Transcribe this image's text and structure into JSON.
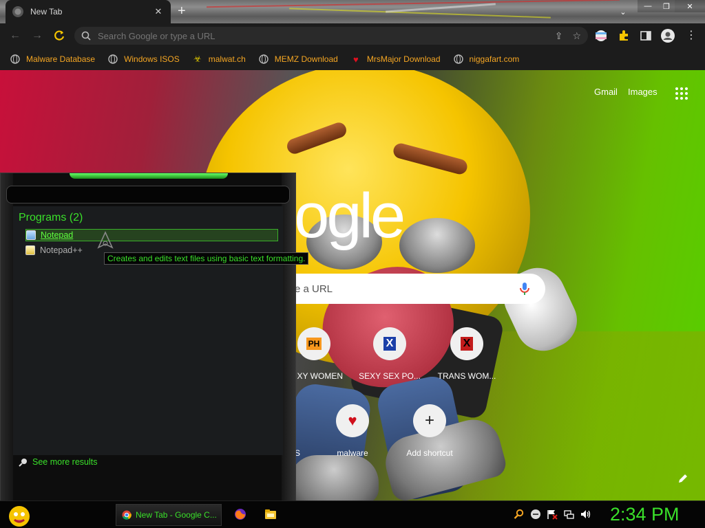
{
  "browser": {
    "tab_title": "New Tab",
    "omnibox_placeholder": "Search Google or type a URL",
    "bookmarks": [
      {
        "label": "Malware Database",
        "icon": "globe-icon"
      },
      {
        "label": "Windows ISOS",
        "icon": "globe-icon"
      },
      {
        "label": "malwat.ch",
        "icon": "biohazard-icon"
      },
      {
        "label": "MEMZ Download",
        "icon": "globe-icon"
      },
      {
        "label": "MrsMajor Download",
        "icon": "heart-icon"
      },
      {
        "label": "niggafart.com",
        "icon": "globe-icon"
      }
    ]
  },
  "newtab": {
    "gmail": "Gmail",
    "images": "Images",
    "logo": "oogle",
    "search_placeholder": "e a URL",
    "shortcuts": [
      {
        "label": "XY WOMEN",
        "icon_text": "PH"
      },
      {
        "label": "SEXY SEX PO...",
        "icon_text": "X"
      },
      {
        "label": "TRANS WOM...",
        "icon_text": "X"
      },
      {
        "label": "S",
        "icon_text": ""
      },
      {
        "label": "malware",
        "icon_text": "♥"
      },
      {
        "label": "Add shortcut",
        "icon_text": "+"
      }
    ]
  },
  "startmenu": {
    "programs_heading": "Programs (2)",
    "programs": [
      "Notepad",
      "Notepad++"
    ],
    "tooltip": "Creates and edits text files using basic text formatting.",
    "see_more": "See more results"
  },
  "taskbar": {
    "task_label": "New Tab - Google C...",
    "clock": "2:34 PM"
  },
  "colors": {
    "accent_green": "#3ae02a",
    "bookmark_orange": "#f5a623"
  }
}
